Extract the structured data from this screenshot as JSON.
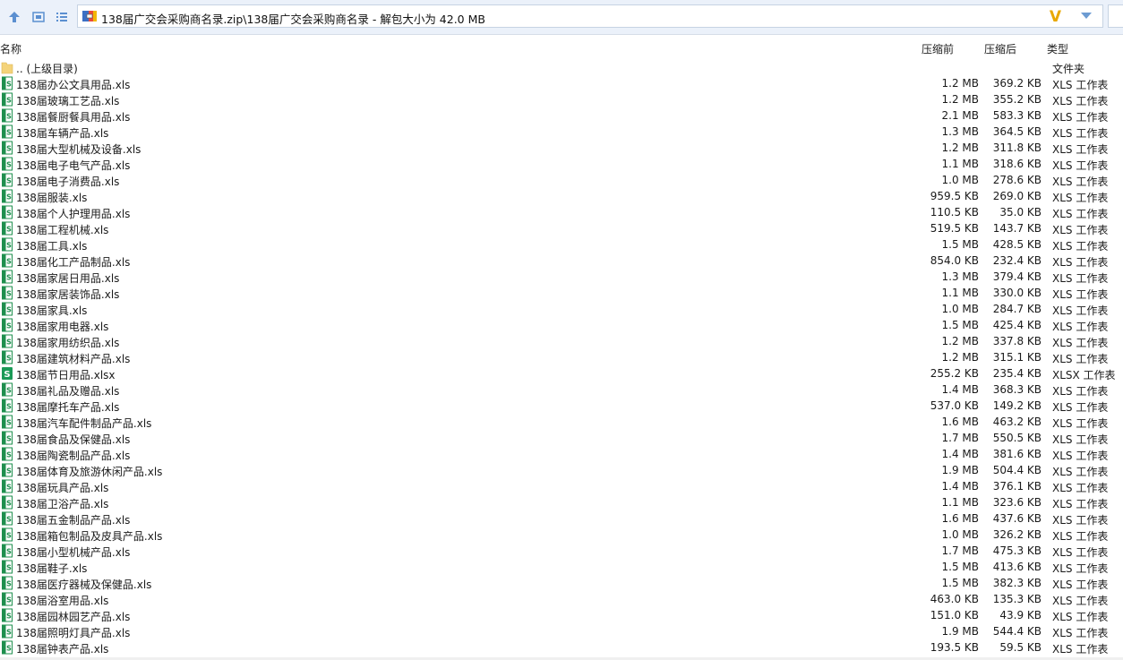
{
  "toolbar": {
    "address": "138届广交会采购商名录.zip\\138届广交会采购商名录 - 解包大小为 42.0 MB",
    "brand_mark": "V"
  },
  "columns": {
    "name": "名称",
    "packed": "压缩前",
    "unpacked": "压缩后",
    "type": "类型"
  },
  "parent": {
    "name": ".. (上级目录)",
    "type": "文件夹"
  },
  "files": [
    {
      "name": "138届办公文具用品.xls",
      "packed": "1.2 MB",
      "unpacked": "369.2 KB",
      "type": "XLS 工作表",
      "kind": "xls"
    },
    {
      "name": "138届玻璃工艺品.xls",
      "packed": "1.2 MB",
      "unpacked": "355.2 KB",
      "type": "XLS 工作表",
      "kind": "xls"
    },
    {
      "name": "138届餐厨餐具用品.xls",
      "packed": "2.1 MB",
      "unpacked": "583.3 KB",
      "type": "XLS 工作表",
      "kind": "xls"
    },
    {
      "name": "138届车辆产品.xls",
      "packed": "1.3 MB",
      "unpacked": "364.5 KB",
      "type": "XLS 工作表",
      "kind": "xls"
    },
    {
      "name": "138届大型机械及设备.xls",
      "packed": "1.2 MB",
      "unpacked": "311.8 KB",
      "type": "XLS 工作表",
      "kind": "xls"
    },
    {
      "name": "138届电子电气产品.xls",
      "packed": "1.1 MB",
      "unpacked": "318.6 KB",
      "type": "XLS 工作表",
      "kind": "xls"
    },
    {
      "name": "138届电子消费品.xls",
      "packed": "1.0 MB",
      "unpacked": "278.6 KB",
      "type": "XLS 工作表",
      "kind": "xls"
    },
    {
      "name": "138届服装.xls",
      "packed": "959.5 KB",
      "unpacked": "269.0 KB",
      "type": "XLS 工作表",
      "kind": "xls"
    },
    {
      "name": "138届个人护理用品.xls",
      "packed": "110.5 KB",
      "unpacked": "35.0 KB",
      "type": "XLS 工作表",
      "kind": "xls"
    },
    {
      "name": "138届工程机械.xls",
      "packed": "519.5 KB",
      "unpacked": "143.7 KB",
      "type": "XLS 工作表",
      "kind": "xls"
    },
    {
      "name": "138届工具.xls",
      "packed": "1.5 MB",
      "unpacked": "428.5 KB",
      "type": "XLS 工作表",
      "kind": "xls"
    },
    {
      "name": "138届化工产品制品.xls",
      "packed": "854.0 KB",
      "unpacked": "232.4 KB",
      "type": "XLS 工作表",
      "kind": "xls"
    },
    {
      "name": "138届家居日用品.xls",
      "packed": "1.3 MB",
      "unpacked": "379.4 KB",
      "type": "XLS 工作表",
      "kind": "xls"
    },
    {
      "name": "138届家居装饰品.xls",
      "packed": "1.1 MB",
      "unpacked": "330.0 KB",
      "type": "XLS 工作表",
      "kind": "xls"
    },
    {
      "name": "138届家具.xls",
      "packed": "1.0 MB",
      "unpacked": "284.7 KB",
      "type": "XLS 工作表",
      "kind": "xls"
    },
    {
      "name": "138届家用电器.xls",
      "packed": "1.5 MB",
      "unpacked": "425.4 KB",
      "type": "XLS 工作表",
      "kind": "xls"
    },
    {
      "name": "138届家用纺织品.xls",
      "packed": "1.2 MB",
      "unpacked": "337.8 KB",
      "type": "XLS 工作表",
      "kind": "xls"
    },
    {
      "name": "138届建筑材料产品.xls",
      "packed": "1.2 MB",
      "unpacked": "315.1 KB",
      "type": "XLS 工作表",
      "kind": "xls"
    },
    {
      "name": "138届节日用品.xlsx",
      "packed": "255.2 KB",
      "unpacked": "235.4 KB",
      "type": "XLSX 工作表",
      "kind": "xlsx"
    },
    {
      "name": "138届礼品及赠品.xls",
      "packed": "1.4 MB",
      "unpacked": "368.3 KB",
      "type": "XLS 工作表",
      "kind": "xls"
    },
    {
      "name": "138届摩托车产品.xls",
      "packed": "537.0 KB",
      "unpacked": "149.2 KB",
      "type": "XLS 工作表",
      "kind": "xls"
    },
    {
      "name": "138届汽车配件制品产品.xls",
      "packed": "1.6 MB",
      "unpacked": "463.2 KB",
      "type": "XLS 工作表",
      "kind": "xls"
    },
    {
      "name": "138届食品及保健品.xls",
      "packed": "1.7 MB",
      "unpacked": "550.5 KB",
      "type": "XLS 工作表",
      "kind": "xls"
    },
    {
      "name": "138届陶瓷制品产品.xls",
      "packed": "1.4 MB",
      "unpacked": "381.6 KB",
      "type": "XLS 工作表",
      "kind": "xls"
    },
    {
      "name": "138届体育及旅游休闲产品.xls",
      "packed": "1.9 MB",
      "unpacked": "504.4 KB",
      "type": "XLS 工作表",
      "kind": "xls"
    },
    {
      "name": "138届玩具产品.xls",
      "packed": "1.4 MB",
      "unpacked": "376.1 KB",
      "type": "XLS 工作表",
      "kind": "xls"
    },
    {
      "name": "138届卫浴产品.xls",
      "packed": "1.1 MB",
      "unpacked": "323.6 KB",
      "type": "XLS 工作表",
      "kind": "xls"
    },
    {
      "name": "138届五金制品产品.xls",
      "packed": "1.6 MB",
      "unpacked": "437.6 KB",
      "type": "XLS 工作表",
      "kind": "xls"
    },
    {
      "name": "138届箱包制品及皮具产品.xls",
      "packed": "1.0 MB",
      "unpacked": "326.2 KB",
      "type": "XLS 工作表",
      "kind": "xls"
    },
    {
      "name": "138届小型机械产品.xls",
      "packed": "1.7 MB",
      "unpacked": "475.3 KB",
      "type": "XLS 工作表",
      "kind": "xls"
    },
    {
      "name": "138届鞋子.xls",
      "packed": "1.5 MB",
      "unpacked": "413.6 KB",
      "type": "XLS 工作表",
      "kind": "xls"
    },
    {
      "name": "138届医疗器械及保健品.xls",
      "packed": "1.5 MB",
      "unpacked": "382.3 KB",
      "type": "XLS 工作表",
      "kind": "xls"
    },
    {
      "name": "138届浴室用品.xls",
      "packed": "463.0 KB",
      "unpacked": "135.3 KB",
      "type": "XLS 工作表",
      "kind": "xls"
    },
    {
      "name": "138届园林园艺产品.xls",
      "packed": "151.0 KB",
      "unpacked": "43.9 KB",
      "type": "XLS 工作表",
      "kind": "xls"
    },
    {
      "name": "138届照明灯具产品.xls",
      "packed": "1.9 MB",
      "unpacked": "544.4 KB",
      "type": "XLS 工作表",
      "kind": "xls"
    },
    {
      "name": "138届钟表产品.xls",
      "packed": "193.5 KB",
      "unpacked": "59.5 KB",
      "type": "XLS 工作表",
      "kind": "xls"
    }
  ],
  "colors": {
    "toolbar_bg": "#ebf1fa",
    "folder": "#f4d37a",
    "xls_icon": "#1e8f4e",
    "xlsx_icon": "#1a9a57"
  }
}
